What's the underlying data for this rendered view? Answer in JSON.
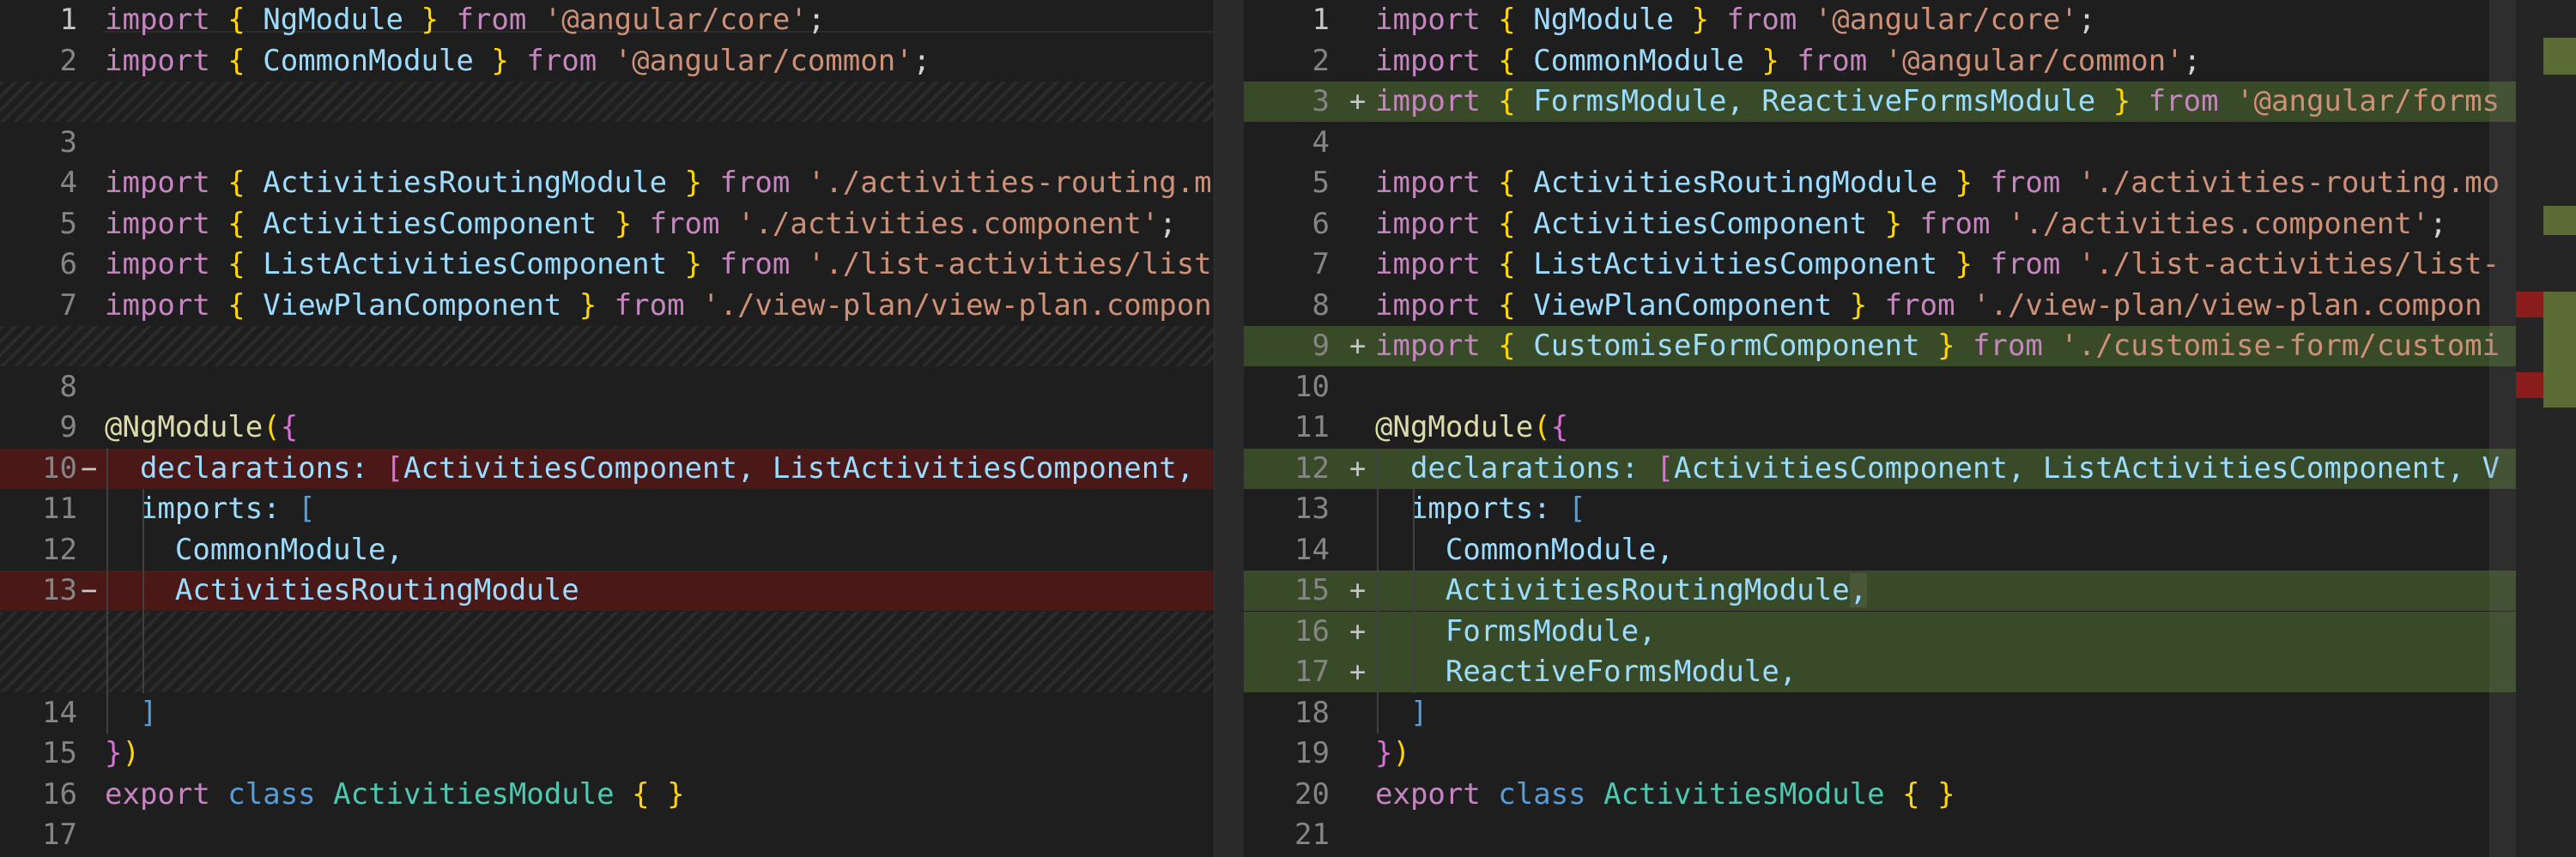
{
  "colors": {
    "removed": "#4b1818",
    "added": "#394a28",
    "overview_added": "#5a6b34",
    "overview_removed": "#8b1c1c"
  },
  "left": {
    "rows": [
      {
        "num": "1",
        "marker": "",
        "type": "normal",
        "tokens": [
          [
            "import ",
            "kw"
          ],
          [
            "{ ",
            "b1"
          ],
          [
            "NgModule",
            "id"
          ],
          [
            " } ",
            "b1"
          ],
          [
            "from ",
            "kw"
          ],
          [
            "'@angular/core'",
            "str"
          ],
          [
            ";",
            "p"
          ]
        ]
      },
      {
        "num": "2",
        "marker": "",
        "type": "normal",
        "tokens": [
          [
            "import ",
            "kw"
          ],
          [
            "{ ",
            "b1"
          ],
          [
            "CommonModule",
            "id"
          ],
          [
            " } ",
            "b1"
          ],
          [
            "from ",
            "kw"
          ],
          [
            "'@angular/common'",
            "str"
          ],
          [
            ";",
            "p"
          ]
        ]
      },
      {
        "num": "",
        "marker": "",
        "type": "filler",
        "tokens": []
      },
      {
        "num": "3",
        "marker": "",
        "type": "normal",
        "tokens": []
      },
      {
        "num": "4",
        "marker": "",
        "type": "normal",
        "tokens": [
          [
            "import ",
            "kw"
          ],
          [
            "{ ",
            "b1"
          ],
          [
            "ActivitiesRoutingModule",
            "id"
          ],
          [
            " } ",
            "b1"
          ],
          [
            "from ",
            "kw"
          ],
          [
            "'./activities-routing.mo",
            "str"
          ]
        ]
      },
      {
        "num": "5",
        "marker": "",
        "type": "normal",
        "tokens": [
          [
            "import ",
            "kw"
          ],
          [
            "{ ",
            "b1"
          ],
          [
            "ActivitiesComponent",
            "id"
          ],
          [
            " } ",
            "b1"
          ],
          [
            "from ",
            "kw"
          ],
          [
            "'./activities.component'",
            "str"
          ],
          [
            ";",
            "p"
          ]
        ]
      },
      {
        "num": "6",
        "marker": "",
        "type": "normal",
        "tokens": [
          [
            "import ",
            "kw"
          ],
          [
            "{ ",
            "b1"
          ],
          [
            "ListActivitiesComponent",
            "id"
          ],
          [
            " } ",
            "b1"
          ],
          [
            "from ",
            "kw"
          ],
          [
            "'./list-activities/list",
            "str"
          ]
        ]
      },
      {
        "num": "7",
        "marker": "",
        "type": "normal",
        "tokens": [
          [
            "import ",
            "kw"
          ],
          [
            "{ ",
            "b1"
          ],
          [
            "ViewPlanComponent",
            "id"
          ],
          [
            " } ",
            "b1"
          ],
          [
            "from ",
            "kw"
          ],
          [
            "'./view-plan/view-plan.compon",
            "str"
          ]
        ]
      },
      {
        "num": "",
        "marker": "",
        "type": "filler",
        "tokens": []
      },
      {
        "num": "8",
        "marker": "",
        "type": "normal",
        "tokens": []
      },
      {
        "num": "9",
        "marker": "",
        "type": "normal",
        "tokens": [
          [
            "@NgModule",
            "dec"
          ],
          [
            "(",
            "b1"
          ],
          [
            "{",
            "b2"
          ]
        ]
      },
      {
        "num": "10",
        "marker": "−",
        "type": "removed",
        "tokens": [
          [
            "  declarations: ",
            "id"
          ],
          [
            "[",
            "b2"
          ],
          [
            "ActivitiesComponent, ListActivitiesComponent, ",
            "id"
          ]
        ]
      },
      {
        "num": "11",
        "marker": "",
        "type": "normal",
        "tokens": [
          [
            "  imports: ",
            "id"
          ],
          [
            "[",
            "kw2"
          ]
        ]
      },
      {
        "num": "12",
        "marker": "",
        "type": "normal",
        "tokens": [
          [
            "    CommonModule,",
            "id"
          ]
        ]
      },
      {
        "num": "13",
        "marker": "−",
        "type": "removed",
        "tokens": [
          [
            "    ActivitiesRoutingModule",
            "id"
          ]
        ]
      },
      {
        "num": "",
        "marker": "",
        "type": "filler",
        "tokens": []
      },
      {
        "num": "",
        "marker": "",
        "type": "filler",
        "tokens": []
      },
      {
        "num": "14",
        "marker": "",
        "type": "normal",
        "tokens": [
          [
            "  ",
            "p"
          ],
          [
            "]",
            "kw2"
          ]
        ]
      },
      {
        "num": "15",
        "marker": "",
        "type": "normal",
        "tokens": [
          [
            "}",
            "b2"
          ],
          [
            ")",
            "b1"
          ]
        ]
      },
      {
        "num": "16",
        "marker": "",
        "type": "normal",
        "tokens": [
          [
            "export ",
            "kw"
          ],
          [
            "class ",
            "kw2"
          ],
          [
            "ActivitiesModule ",
            "cls"
          ],
          [
            "{ }",
            "b1"
          ]
        ]
      },
      {
        "num": "17",
        "marker": "",
        "type": "normal",
        "tokens": []
      }
    ]
  },
  "right": {
    "rows": [
      {
        "num": "1",
        "marker": "",
        "type": "normal",
        "tokens": [
          [
            "import ",
            "kw"
          ],
          [
            "{ ",
            "b1"
          ],
          [
            "NgModule",
            "id"
          ],
          [
            " } ",
            "b1"
          ],
          [
            "from ",
            "kw"
          ],
          [
            "'@angular/core'",
            "str"
          ],
          [
            ";",
            "p"
          ]
        ]
      },
      {
        "num": "2",
        "marker": "",
        "type": "normal",
        "tokens": [
          [
            "import ",
            "kw"
          ],
          [
            "{ ",
            "b1"
          ],
          [
            "CommonModule",
            "id"
          ],
          [
            " } ",
            "b1"
          ],
          [
            "from ",
            "kw"
          ],
          [
            "'@angular/common'",
            "str"
          ],
          [
            ";",
            "p"
          ]
        ]
      },
      {
        "num": "3",
        "marker": "+",
        "type": "added",
        "tokens": [
          [
            "import ",
            "kw"
          ],
          [
            "{ ",
            "b1"
          ],
          [
            "FormsModule, ReactiveFormsModule",
            "id"
          ],
          [
            " } ",
            "b1"
          ],
          [
            "from ",
            "kw"
          ],
          [
            "'@angular/forms",
            "str"
          ]
        ]
      },
      {
        "num": "4",
        "marker": "",
        "type": "normal",
        "tokens": []
      },
      {
        "num": "5",
        "marker": "",
        "type": "normal",
        "tokens": [
          [
            "import ",
            "kw"
          ],
          [
            "{ ",
            "b1"
          ],
          [
            "ActivitiesRoutingModule",
            "id"
          ],
          [
            " } ",
            "b1"
          ],
          [
            "from ",
            "kw"
          ],
          [
            "'./activities-routing.mo",
            "str"
          ]
        ]
      },
      {
        "num": "6",
        "marker": "",
        "type": "normal",
        "tokens": [
          [
            "import ",
            "kw"
          ],
          [
            "{ ",
            "b1"
          ],
          [
            "ActivitiesComponent",
            "id"
          ],
          [
            " } ",
            "b1"
          ],
          [
            "from ",
            "kw"
          ],
          [
            "'./activities.component'",
            "str"
          ],
          [
            ";",
            "p"
          ]
        ]
      },
      {
        "num": "7",
        "marker": "",
        "type": "normal",
        "tokens": [
          [
            "import ",
            "kw"
          ],
          [
            "{ ",
            "b1"
          ],
          [
            "ListActivitiesComponent",
            "id"
          ],
          [
            " } ",
            "b1"
          ],
          [
            "from ",
            "kw"
          ],
          [
            "'./list-activities/list-",
            "str"
          ]
        ]
      },
      {
        "num": "8",
        "marker": "",
        "type": "normal",
        "tokens": [
          [
            "import ",
            "kw"
          ],
          [
            "{ ",
            "b1"
          ],
          [
            "ViewPlanComponent",
            "id"
          ],
          [
            " } ",
            "b1"
          ],
          [
            "from ",
            "kw"
          ],
          [
            "'./view-plan/view-plan.compon",
            "str"
          ]
        ]
      },
      {
        "num": "9",
        "marker": "+",
        "type": "added",
        "tokens": [
          [
            "import ",
            "kw"
          ],
          [
            "{ ",
            "b1"
          ],
          [
            "CustomiseFormComponent",
            "id"
          ],
          [
            " } ",
            "b1"
          ],
          [
            "from ",
            "kw"
          ],
          [
            "'./customise-form/customi",
            "str"
          ]
        ]
      },
      {
        "num": "10",
        "marker": "",
        "type": "normal",
        "tokens": []
      },
      {
        "num": "11",
        "marker": "",
        "type": "normal",
        "tokens": [
          [
            "@NgModule",
            "dec"
          ],
          [
            "(",
            "b1"
          ],
          [
            "{",
            "b2"
          ]
        ]
      },
      {
        "num": "12",
        "marker": "+",
        "type": "added",
        "tokens": [
          [
            "  declarations: ",
            "id"
          ],
          [
            "[",
            "b2"
          ],
          [
            "ActivitiesComponent, ListActivitiesComponent, V",
            "id"
          ]
        ]
      },
      {
        "num": "13",
        "marker": "",
        "type": "normal",
        "tokens": [
          [
            "  imports: ",
            "id"
          ],
          [
            "[",
            "kw2"
          ]
        ]
      },
      {
        "num": "14",
        "marker": "",
        "type": "normal",
        "tokens": [
          [
            "    CommonModule,",
            "id"
          ]
        ]
      },
      {
        "num": "15",
        "marker": "+",
        "type": "added",
        "tokens": [
          [
            "    ActivitiesRoutingModule",
            "id"
          ],
          [
            ",",
            "ws"
          ]
        ]
      },
      {
        "num": "16",
        "marker": "+",
        "type": "added",
        "tokens": [
          [
            "    FormsModule,",
            "id"
          ]
        ]
      },
      {
        "num": "17",
        "marker": "+",
        "type": "added",
        "tokens": [
          [
            "    ReactiveFormsModule,",
            "id"
          ]
        ]
      },
      {
        "num": "18",
        "marker": "",
        "type": "normal",
        "tokens": [
          [
            "  ",
            "p"
          ],
          [
            "]",
            "kw2"
          ]
        ]
      },
      {
        "num": "19",
        "marker": "",
        "type": "normal",
        "tokens": [
          [
            "}",
            "b2"
          ],
          [
            ")",
            "b1"
          ]
        ]
      },
      {
        "num": "20",
        "marker": "",
        "type": "normal",
        "tokens": [
          [
            "export ",
            "kw"
          ],
          [
            "class ",
            "kw2"
          ],
          [
            "ActivitiesModule ",
            "cls"
          ],
          [
            "{ }",
            "b1"
          ]
        ]
      },
      {
        "num": "21",
        "marker": "",
        "type": "normal",
        "tokens": []
      }
    ]
  }
}
